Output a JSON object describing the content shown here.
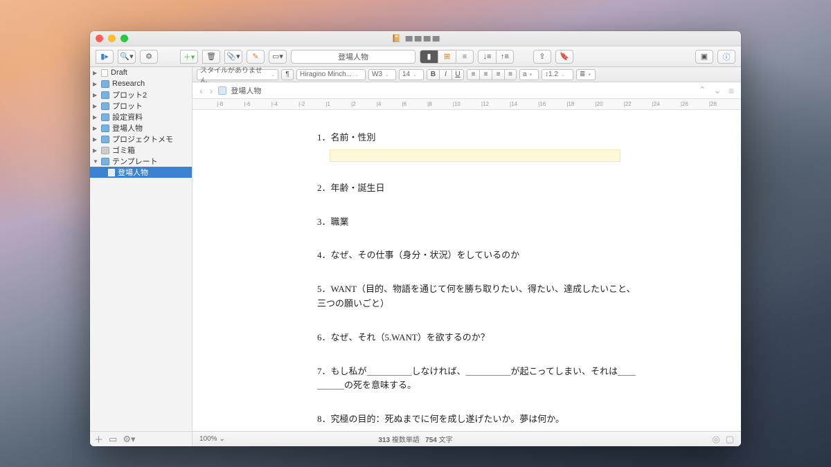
{
  "window_title": "",
  "toolbar": {
    "document_title": "登場人物"
  },
  "sidebar": {
    "items": [
      {
        "label": "Draft",
        "type": "folder",
        "expanded": false
      },
      {
        "label": "Research",
        "type": "folder",
        "expanded": false
      },
      {
        "label": "プロット2",
        "type": "folder",
        "expanded": false
      },
      {
        "label": "プロット",
        "type": "folder",
        "expanded": false
      },
      {
        "label": "設定資料",
        "type": "folder",
        "expanded": false
      },
      {
        "label": "登場人物",
        "type": "folder",
        "expanded": false
      },
      {
        "label": "プロジェクトメモ",
        "type": "folder",
        "expanded": false
      },
      {
        "label": "ゴミ箱",
        "type": "trash",
        "expanded": false
      },
      {
        "label": "テンプレート",
        "type": "folder",
        "expanded": true
      },
      {
        "label": "登場人物",
        "type": "doc",
        "selected": true,
        "child": true
      }
    ]
  },
  "format": {
    "style": "スタイルがありません",
    "font": "Hiragino Minch...",
    "font_weight": "W3",
    "size": "14",
    "text_color": "a",
    "line_spacing": "1.2"
  },
  "breadcrumb": {
    "title": "登場人物"
  },
  "ruler": [
    "|-8",
    "|-6",
    "|-4",
    "|-2",
    "|1",
    "|2",
    "|4",
    "|6",
    "|8",
    "|10",
    "|12",
    "|14",
    "|16",
    "|18",
    "|20",
    "|22",
    "|24",
    "|26",
    "|28"
  ],
  "document": {
    "items": [
      "1．名前・性別",
      "2．年齢・誕生日",
      "3．職業",
      "4．なぜ、その仕事（身分・状況）をしているのか",
      "5．WANT（目的、物語を通じて何を勝ち取りたい、得たい、達成したいこと、三つの願いごと）",
      "6．なぜ、それ（5.WANT）を欲するのか？",
      "7．もし私が＿＿＿＿＿しなければ、＿＿＿＿＿が起こってしまい、それは＿＿＿＿＿の死を意味する。",
      "8．究極の目的：死ぬまでに何を成し遂げたいか。夢は何か。"
    ]
  },
  "status": {
    "zoom": "100%",
    "words_label": "複数単語",
    "words": "313",
    "chars_label": "文字",
    "chars": "754"
  }
}
